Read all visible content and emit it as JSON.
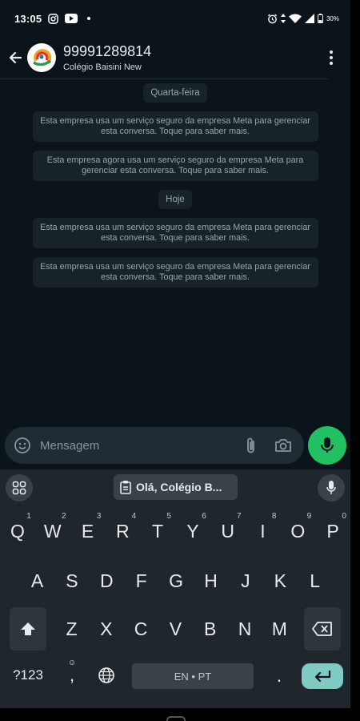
{
  "status": {
    "time": "13:05",
    "battery": "30%"
  },
  "header": {
    "title": "99991289814",
    "subtitle": "Colégio Baisini New"
  },
  "messages": [
    {
      "type": "date",
      "text": "Quarta-feira"
    },
    {
      "type": "system",
      "text": "Esta empresa usa um serviço seguro da empresa Meta para gerenciar esta conversa. Toque para saber mais."
    },
    {
      "type": "system",
      "text": "Esta empresa agora usa um serviço seguro da empresa Meta para gerenciar esta conversa. Toque para saber mais."
    },
    {
      "type": "date",
      "text": "Hoje"
    },
    {
      "type": "system",
      "text": "Esta empresa usa um serviço seguro da empresa Meta para gerenciar esta conversa. Toque para saber mais."
    },
    {
      "type": "system",
      "text": "Esta empresa usa um serviço seguro da empresa Meta para gerenciar esta conversa. Toque para saber mais."
    }
  ],
  "compose": {
    "placeholder": "Mensagem"
  },
  "keyboard": {
    "clipboard_suggestion": "Olá, Colégio B...",
    "row1": [
      {
        "k": "Q",
        "h": "1"
      },
      {
        "k": "W",
        "h": "2"
      },
      {
        "k": "E",
        "h": "3"
      },
      {
        "k": "R",
        "h": "4"
      },
      {
        "k": "T",
        "h": "5"
      },
      {
        "k": "Y",
        "h": "6"
      },
      {
        "k": "U",
        "h": "7"
      },
      {
        "k": "I",
        "h": "8"
      },
      {
        "k": "O",
        "h": "9"
      },
      {
        "k": "P",
        "h": "0"
      }
    ],
    "row2": [
      "A",
      "S",
      "D",
      "F",
      "G",
      "H",
      "J",
      "K",
      "L"
    ],
    "row3": [
      "Z",
      "X",
      "C",
      "V",
      "B",
      "N",
      "M"
    ],
    "symbols_label": "?123",
    "comma_label": ",",
    "space_label": "EN • PT",
    "period_label": "."
  },
  "colors": {
    "background": "#0b141a",
    "bubble": "#182229",
    "accent_green": "#21c063",
    "enter_key": "#7fcac3"
  }
}
